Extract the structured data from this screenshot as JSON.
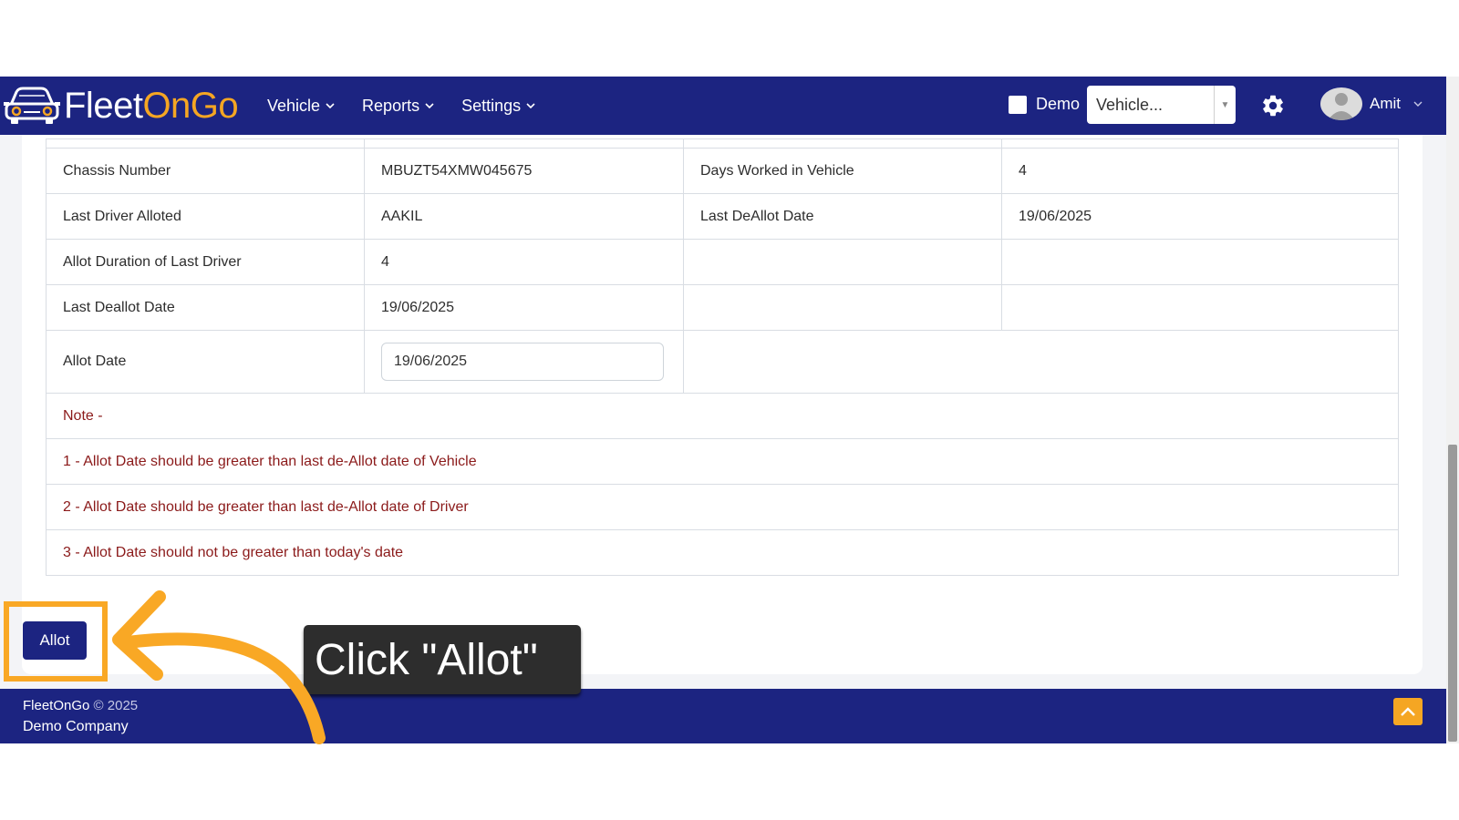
{
  "brand": {
    "name_part1": "Fleet",
    "name_part2": "OnGo"
  },
  "nav": {
    "items": [
      {
        "label": "Vehicle"
      },
      {
        "label": "Reports"
      },
      {
        "label": "Settings"
      }
    ],
    "demo_label": "Demo",
    "vehicle_select": {
      "value": "Vehicle..."
    },
    "user_name": "Amit"
  },
  "details": {
    "rows": [
      {
        "label1": "Chassis Number",
        "value1": "MBUZT54XMW045675",
        "label2": "Days Worked in Vehicle",
        "value2": "4"
      },
      {
        "label1": "Last Driver Alloted",
        "value1": "AAKIL",
        "label2": "Last DeAllot Date",
        "value2": "19/06/2025"
      },
      {
        "label1": "Allot Duration of Last Driver",
        "value1": "4",
        "label2": "",
        "value2": ""
      },
      {
        "label1": "Last Deallot Date",
        "value1": "19/06/2025",
        "label2": "",
        "value2": ""
      }
    ],
    "allot_date": {
      "label": "Allot Date",
      "value": "19/06/2025"
    },
    "notes": [
      "Note -",
      "1 - Allot Date should be greater than last de-Allot date of Vehicle",
      "2 - Allot Date should be greater than last de-Allot date of Driver",
      "3 - Allot Date should not be greater than today's date"
    ]
  },
  "actions": {
    "allot_label": "Allot"
  },
  "footer": {
    "brand": "FleetOnGo",
    "copyright": "© 2025",
    "company": "Demo Company"
  },
  "callout": {
    "text": "Click \"Allot\""
  },
  "colors": {
    "navy": "#1c2481",
    "accent": "#f5a623",
    "highlight": "#f9a825",
    "note_text": "#8b1a1a"
  }
}
